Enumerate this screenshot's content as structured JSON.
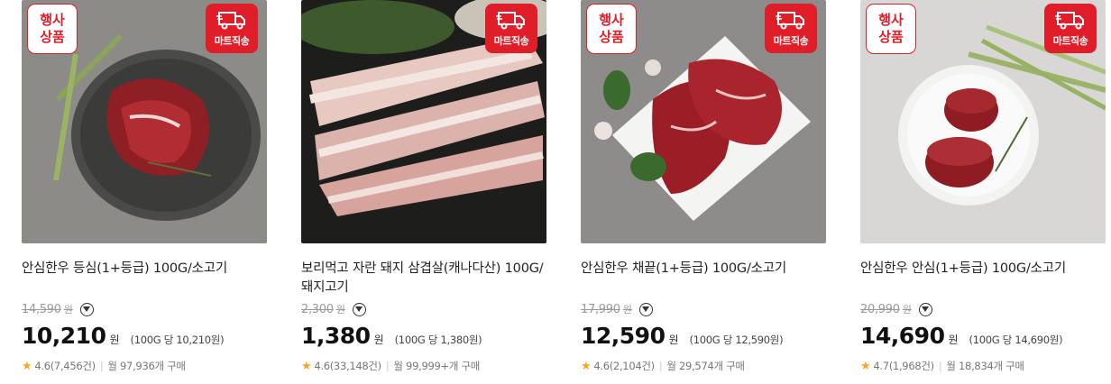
{
  "products": [
    {
      "event_badge": [
        "행사",
        "상품"
      ],
      "ship_label": "마트직송",
      "title": "안심한우 등심(1+등급) 100G/소고기",
      "original_price": "14,590",
      "original_currency": "원",
      "price": "10,210",
      "currency": "원",
      "unit_price": "(100G 당 10,210원)",
      "rating": "4.6",
      "reviews": "(7,456건)",
      "monthly": "월 97,936개 구매"
    },
    {
      "event_badge": null,
      "ship_label": "마트직송",
      "title": "보리먹고 자란 돼지 삼겹살(캐나다산) 100G/돼지고기",
      "original_price": "2,300",
      "original_currency": "원",
      "price": "1,380",
      "currency": "원",
      "unit_price": "(100G 당 1,380원)",
      "rating": "4.6",
      "reviews": "(33,148건)",
      "monthly": "월 99,999+개 구매"
    },
    {
      "event_badge": [
        "행사",
        "상품"
      ],
      "ship_label": "마트직송",
      "title": "안심한우 채끝(1+등급) 100G/소고기",
      "original_price": "17,990",
      "original_currency": "원",
      "price": "12,590",
      "currency": "원",
      "unit_price": "(100G 당 12,590원)",
      "rating": "4.6",
      "reviews": "(2,104건)",
      "monthly": "월 29,574개 구매"
    },
    {
      "event_badge": [
        "행사",
        "상품"
      ],
      "ship_label": "마트직송",
      "title": "안심한우 안심(1+등급) 100G/소고기",
      "original_price": "20,990",
      "original_currency": "원",
      "price": "14,690",
      "currency": "원",
      "unit_price": "(100G 당 14,690원)",
      "rating": "4.7",
      "reviews": "(1,968건)",
      "monthly": "월 18,834개 구매"
    }
  ],
  "icons": {
    "star": "star-icon",
    "expand": "chevron-down-icon",
    "ship": "delivery-truck-icon"
  },
  "colors": {
    "accent_red": "#e01e2a",
    "star_yellow": "#f5a623",
    "strike_gray": "#999999"
  }
}
